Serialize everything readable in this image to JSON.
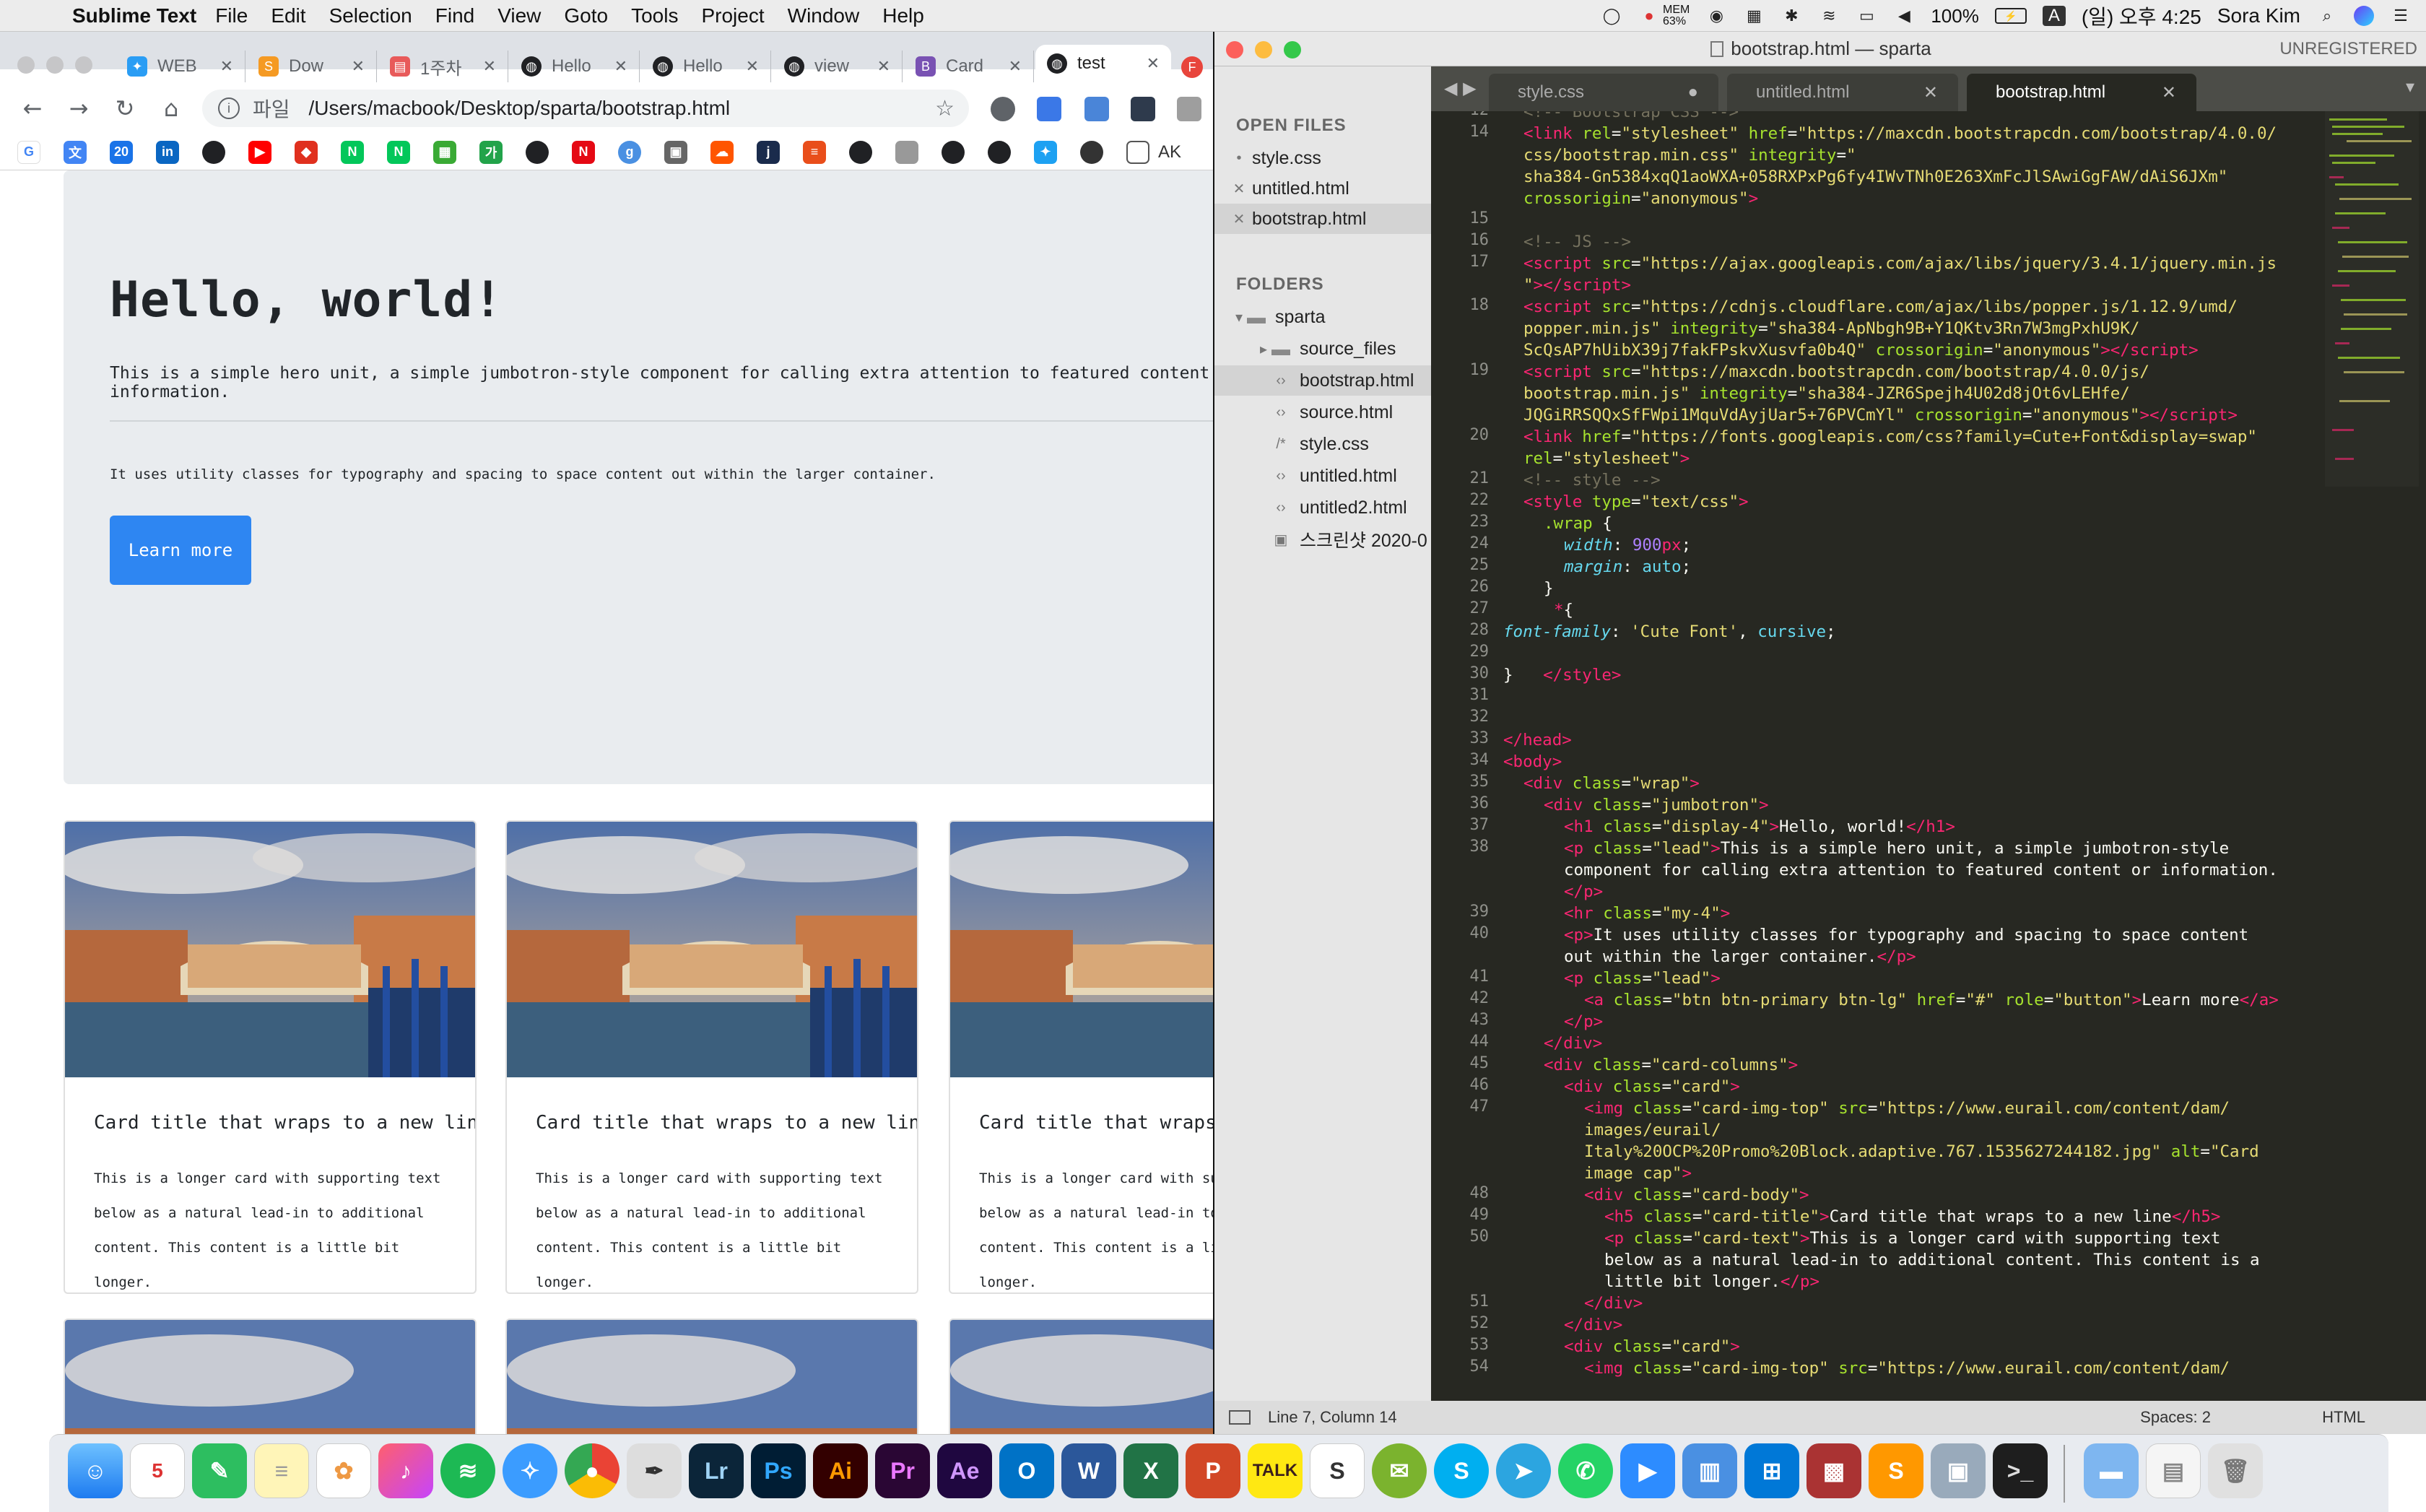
{
  "menubar": {
    "app_name": "Sublime Text",
    "menus": [
      "File",
      "Edit",
      "Selection",
      "Find",
      "View",
      "Goto",
      "Tools",
      "Project",
      "Window",
      "Help"
    ],
    "mem_label": "MEM",
    "mem_value": "63%",
    "battery": "100%",
    "input_source": "A",
    "clock": "(일) 오후 4:25",
    "user": "Sora Kim"
  },
  "chrome": {
    "tabs": [
      {
        "label": "WEB",
        "icon": "bird-icon",
        "color": "#2a9df4"
      },
      {
        "label": "Dow",
        "icon": "sublime-icon",
        "color": "#f59a23"
      },
      {
        "label": "1주차",
        "icon": "doc-icon",
        "color": "#e85a5a"
      },
      {
        "label": "Hello",
        "icon": "globe-icon",
        "color": "#202124"
      },
      {
        "label": "Hello",
        "icon": "globe-icon",
        "color": "#202124"
      },
      {
        "label": "view",
        "icon": "globe-icon",
        "color": "#202124"
      },
      {
        "label": "Card",
        "icon": "bootstrap-icon",
        "color": "#7952b3"
      },
      {
        "label": "test",
        "icon": "globe-icon",
        "color": "#202124"
      }
    ],
    "url_scheme": "파일",
    "url": "/Users/macbook/Desktop/sparta/bootstrap.html",
    "bookmark_text": "AK"
  },
  "page": {
    "title": "Hello, world!",
    "lead": "This is a simple hero unit, a simple jumbotron-style component for calling extra attention to featured content or information.",
    "small": "It uses utility classes for typography and spacing to space content out within the larger container.",
    "button": "Learn more",
    "cards": [
      {
        "title": "Card title that wraps to a new line",
        "text": "This is a longer card with supporting text below as a natural lead-in to additional content. This content is a little bit longer."
      },
      {
        "title": "Card title that wraps to a new line",
        "text": "This is a longer card with supporting text below as a natural lead-in to additional content. This content is a little bit longer."
      },
      {
        "title": "Card title that wraps to a new line",
        "text": "This is a longer card with supporting text below as a natural lead-in to additional content. This content is a little bit longer."
      }
    ]
  },
  "sublime": {
    "window_title": "bootstrap.html — sparta",
    "unregistered": "UNREGISTERED",
    "sidebar": {
      "open_files_heading": "OPEN FILES",
      "open_files": [
        "style.css",
        "untitled.html",
        "bootstrap.html"
      ],
      "folders_heading": "FOLDERS",
      "root_folder": "sparta",
      "items": [
        "source_files",
        "bootstrap.html",
        "source.html",
        "style.css",
        "untitled.html",
        "untitled2.html",
        "스크린샷 2020-0"
      ]
    },
    "tabs": [
      "style.css",
      "untitled.html",
      "bootstrap.html"
    ],
    "status": {
      "position": "Line 7, Column 14",
      "spaces": "Spaces: 2",
      "syntax": "HTML"
    }
  }
}
